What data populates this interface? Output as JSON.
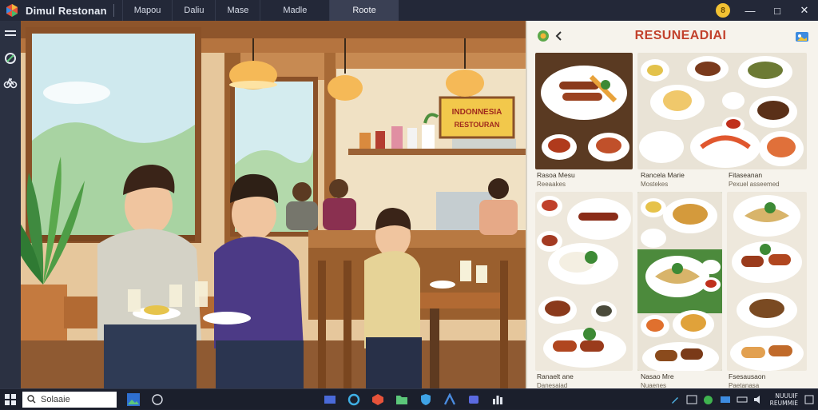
{
  "window": {
    "title": "Dimul Restonan",
    "tabs": [
      {
        "label": "Mapou",
        "active": false
      },
      {
        "label": "Daliu",
        "active": false
      },
      {
        "label": "Mase",
        "active": false
      },
      {
        "label": "Madle",
        "active": false
      },
      {
        "label": "Roote",
        "active": true
      }
    ],
    "coin_label": "8"
  },
  "sidebar": {
    "icons": [
      "menu-icon",
      "dish-icon",
      "bike-icon"
    ]
  },
  "scene": {
    "sign_line1": "INDONNESIA",
    "sign_line2": "RESTOURAN"
  },
  "menu": {
    "title": "RESUNEADIAI",
    "captions": [
      {
        "title": "Rasoa Mesu",
        "sub": "Reeaakes"
      },
      {
        "title": "Rancela Marie",
        "sub": "Mostekes"
      },
      {
        "title": "Fitaseanan",
        "sub": "Pexuel asseemed"
      },
      {
        "title": "Ranaelt ane",
        "sub": "Danesaiad"
      },
      {
        "title": "Nasao Mre",
        "sub": "Nuaenes"
      },
      {
        "title": "Fsesausaon",
        "sub": "Paetanasa"
      }
    ]
  },
  "taskbar": {
    "search_text": "Solaaie",
    "clock_line1": "NUUUIF",
    "clock_line2": "REUMMIE"
  },
  "colors": {
    "titlebar": "#232838",
    "menu_title": "#c2412c",
    "taskbar": "#1b1f2c"
  }
}
